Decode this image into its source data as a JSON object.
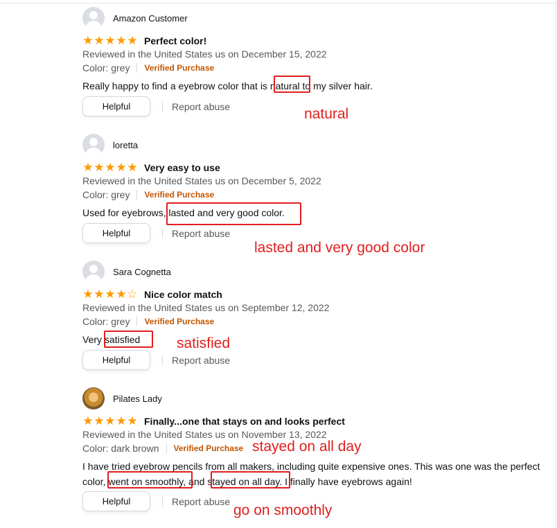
{
  "reviews": [
    {
      "author": "Amazon Customer",
      "stars": [
        "★",
        "★",
        "★",
        "★",
        "★"
      ],
      "title": "Perfect color!",
      "date": "Reviewed in the United States us on December 15, 2022",
      "color": "Color: grey",
      "verified": "Verified Purchase",
      "body_before": "Really happy to find a eyebrow color that is ",
      "body_highlight": "natural",
      "body_after": " to my silver hair.",
      "helpful": "Helpful",
      "report": "Report abuse",
      "annotation": "natural"
    },
    {
      "author": "loretta",
      "stars": [
        "★",
        "★",
        "★",
        "★",
        "★"
      ],
      "title": "Very easy to use",
      "date": "Reviewed in the United States us on December 5, 2022",
      "color": "Color: grey",
      "verified": "Verified Purchase",
      "body_before": "Used for eyebrows, ",
      "body_highlight": "lasted and very good color.",
      "body_after": "",
      "helpful": "Helpful",
      "report": "Report abuse",
      "annotation": "lasted and very good color"
    },
    {
      "author": "Sara Cognetta",
      "stars": [
        "★",
        "★",
        "★",
        "★",
        "☆"
      ],
      "title": "Nice color match",
      "date": "Reviewed in the United States us on September 12, 2022",
      "color": "Color: grey",
      "verified": "Verified Purchase",
      "body_before": "Very ",
      "body_highlight": "satisfied",
      "body_after": "",
      "helpful": "Helpful",
      "report": "Report abuse",
      "annotation": "satisfied"
    },
    {
      "author": "Pilates Lady",
      "stars": [
        "★",
        "★",
        "★",
        "★",
        "★"
      ],
      "title": "Finally...one that stays on and looks perfect",
      "date": "Reviewed in the United States us on November 13, 2022",
      "color": "Color: dark brown",
      "verified": "Verified Purchase",
      "body_line1": "I have tried eyebrow pencils from all makers, including quite expensive ones. This was one was the perfect",
      "body_line2_a": "color, ",
      "body_line2_h1": "went on smoothly,",
      "body_line2_b": " and ",
      "body_line2_h2": "stayed on all day.",
      "body_line2_c": " I finally have eyebrows again!",
      "helpful": "Helpful",
      "report": "Report abuse",
      "annotation_1": "stayed on all day",
      "annotation_2": "go on smoothly"
    }
  ],
  "colors": {
    "star": "#ff9900",
    "verified": "#c45500",
    "annotation": "#e01e1e"
  }
}
